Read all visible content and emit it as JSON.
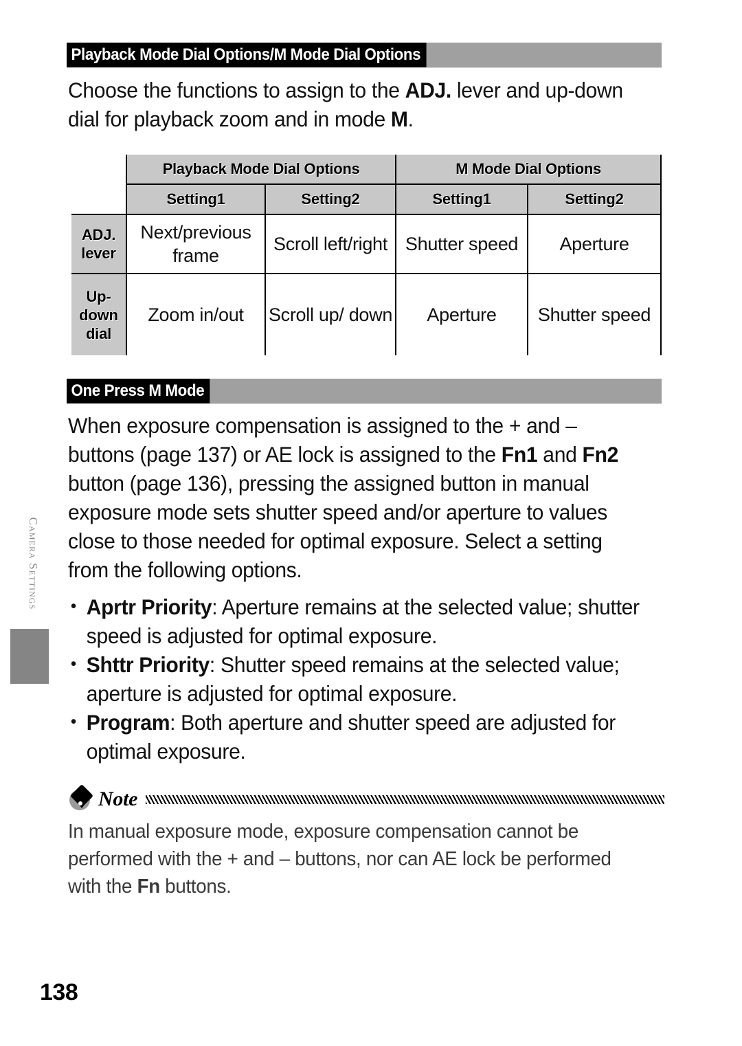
{
  "page": {
    "number": "138",
    "side_tab_label": "Camera Settings"
  },
  "section_1": {
    "heading": "Playback Mode Dial Options/M Mode Dial Options",
    "intro_part_1": "Choose the functions to assign to the ",
    "intro_bold_1": "ADJ.",
    "intro_part_2": " lever and up-down dial for playback zoom and in mode ",
    "intro_bold_2": "M",
    "intro_part_3": "."
  },
  "table": {
    "group_headers": [
      "Playback Mode Dial Options",
      "M Mode Dial Options"
    ],
    "sub_headers": [
      "Setting1",
      "Setting2",
      "Setting1",
      "Setting2"
    ],
    "rows": [
      {
        "label": "ADJ. lever",
        "label_line_1": "ADJ.",
        "label_line_2": "lever",
        "cells": [
          "Next/previous frame",
          "Scroll left/right",
          "Shutter speed",
          "Aperture"
        ]
      },
      {
        "label": "Up-down dial",
        "label_line_1": "Up-",
        "label_line_2": "down",
        "label_line_3": "dial",
        "cells": [
          "Zoom in/out",
          "Scroll up/ down",
          "Aperture",
          "Shutter speed"
        ]
      }
    ]
  },
  "section_2": {
    "heading": "One Press M Mode",
    "para_part_1": "When exposure compensation is assigned to the + and – buttons (page 137) or AE lock is assigned to the ",
    "para_bold_1": "Fn1",
    "para_part_2": " and ",
    "para_bold_2": "Fn2",
    "para_part_3": " button (page 136), pressing the assigned button in manual exposure mode sets shutter speed and/or aperture to values close to those needed for optimal exposure. Select a setting from the following options.",
    "bullets": [
      {
        "term": "Aprtr Priority",
        "text": ": Aperture remains at the selected value; shutter speed is adjusted for optimal exposure."
      },
      {
        "term": "Shttr Priority",
        "text": ": Shutter speed remains at the selected value; aperture is adjusted for optimal exposure."
      },
      {
        "term": "Program",
        "text": ": Both aperture and shutter speed are adjusted for optimal exposure."
      }
    ]
  },
  "note": {
    "label": "Note",
    "body_part_1": "In manual exposure mode, exposure compensation cannot be performed with the + and – buttons, nor can AE lock be performed with the ",
    "body_bold_1": "Fn",
    "body_part_2": " buttons."
  }
}
